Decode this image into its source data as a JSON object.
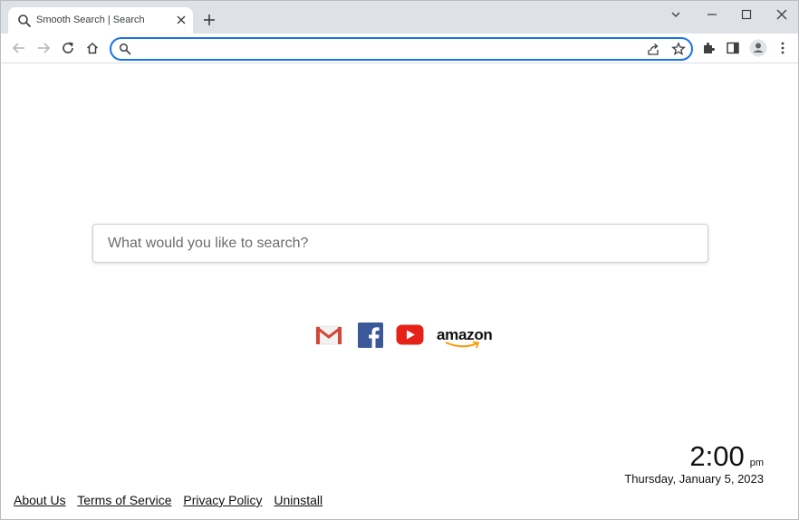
{
  "browser": {
    "tab": {
      "title": "Smooth Search | Search"
    },
    "omnibox": {
      "value": ""
    }
  },
  "page": {
    "search": {
      "placeholder": "What would you like to search?"
    },
    "quick_links": [
      "gmail-icon",
      "facebook-icon",
      "youtube-icon",
      "amazon-logo"
    ],
    "amazon_label": "amazon",
    "clock": {
      "time": "2:00",
      "ampm": "pm",
      "date": "Thursday, January 5, 2023"
    },
    "footer": {
      "about": "About Us",
      "terms": "Terms of Service",
      "privacy": "Privacy Policy",
      "uninstall": "Uninstall"
    }
  },
  "colors": {
    "focus_ring": "#1a73e8",
    "tab_strip": "#dee1e6"
  }
}
